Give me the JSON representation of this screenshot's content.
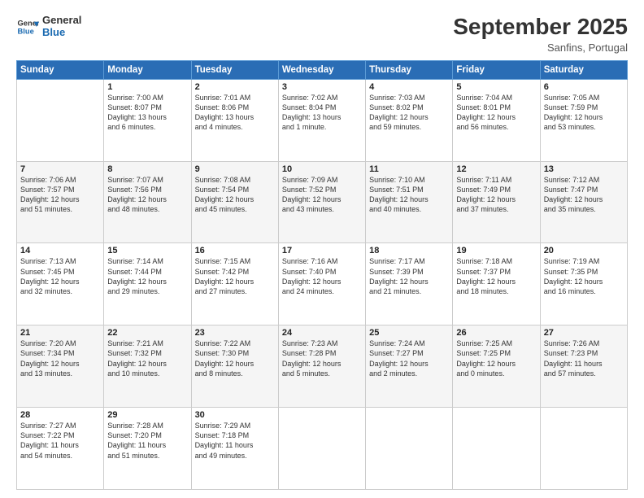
{
  "logo": {
    "line1": "General",
    "line2": "Blue"
  },
  "title": "September 2025",
  "subtitle": "Sanfins, Portugal",
  "days_header": [
    "Sunday",
    "Monday",
    "Tuesday",
    "Wednesday",
    "Thursday",
    "Friday",
    "Saturday"
  ],
  "weeks": [
    [
      {
        "day": "",
        "info": ""
      },
      {
        "day": "1",
        "info": "Sunrise: 7:00 AM\nSunset: 8:07 PM\nDaylight: 13 hours\nand 6 minutes."
      },
      {
        "day": "2",
        "info": "Sunrise: 7:01 AM\nSunset: 8:06 PM\nDaylight: 13 hours\nand 4 minutes."
      },
      {
        "day": "3",
        "info": "Sunrise: 7:02 AM\nSunset: 8:04 PM\nDaylight: 13 hours\nand 1 minute."
      },
      {
        "day": "4",
        "info": "Sunrise: 7:03 AM\nSunset: 8:02 PM\nDaylight: 12 hours\nand 59 minutes."
      },
      {
        "day": "5",
        "info": "Sunrise: 7:04 AM\nSunset: 8:01 PM\nDaylight: 12 hours\nand 56 minutes."
      },
      {
        "day": "6",
        "info": "Sunrise: 7:05 AM\nSunset: 7:59 PM\nDaylight: 12 hours\nand 53 minutes."
      }
    ],
    [
      {
        "day": "7",
        "info": "Sunrise: 7:06 AM\nSunset: 7:57 PM\nDaylight: 12 hours\nand 51 minutes."
      },
      {
        "day": "8",
        "info": "Sunrise: 7:07 AM\nSunset: 7:56 PM\nDaylight: 12 hours\nand 48 minutes."
      },
      {
        "day": "9",
        "info": "Sunrise: 7:08 AM\nSunset: 7:54 PM\nDaylight: 12 hours\nand 45 minutes."
      },
      {
        "day": "10",
        "info": "Sunrise: 7:09 AM\nSunset: 7:52 PM\nDaylight: 12 hours\nand 43 minutes."
      },
      {
        "day": "11",
        "info": "Sunrise: 7:10 AM\nSunset: 7:51 PM\nDaylight: 12 hours\nand 40 minutes."
      },
      {
        "day": "12",
        "info": "Sunrise: 7:11 AM\nSunset: 7:49 PM\nDaylight: 12 hours\nand 37 minutes."
      },
      {
        "day": "13",
        "info": "Sunrise: 7:12 AM\nSunset: 7:47 PM\nDaylight: 12 hours\nand 35 minutes."
      }
    ],
    [
      {
        "day": "14",
        "info": "Sunrise: 7:13 AM\nSunset: 7:45 PM\nDaylight: 12 hours\nand 32 minutes."
      },
      {
        "day": "15",
        "info": "Sunrise: 7:14 AM\nSunset: 7:44 PM\nDaylight: 12 hours\nand 29 minutes."
      },
      {
        "day": "16",
        "info": "Sunrise: 7:15 AM\nSunset: 7:42 PM\nDaylight: 12 hours\nand 27 minutes."
      },
      {
        "day": "17",
        "info": "Sunrise: 7:16 AM\nSunset: 7:40 PM\nDaylight: 12 hours\nand 24 minutes."
      },
      {
        "day": "18",
        "info": "Sunrise: 7:17 AM\nSunset: 7:39 PM\nDaylight: 12 hours\nand 21 minutes."
      },
      {
        "day": "19",
        "info": "Sunrise: 7:18 AM\nSunset: 7:37 PM\nDaylight: 12 hours\nand 18 minutes."
      },
      {
        "day": "20",
        "info": "Sunrise: 7:19 AM\nSunset: 7:35 PM\nDaylight: 12 hours\nand 16 minutes."
      }
    ],
    [
      {
        "day": "21",
        "info": "Sunrise: 7:20 AM\nSunset: 7:34 PM\nDaylight: 12 hours\nand 13 minutes."
      },
      {
        "day": "22",
        "info": "Sunrise: 7:21 AM\nSunset: 7:32 PM\nDaylight: 12 hours\nand 10 minutes."
      },
      {
        "day": "23",
        "info": "Sunrise: 7:22 AM\nSunset: 7:30 PM\nDaylight: 12 hours\nand 8 minutes."
      },
      {
        "day": "24",
        "info": "Sunrise: 7:23 AM\nSunset: 7:28 PM\nDaylight: 12 hours\nand 5 minutes."
      },
      {
        "day": "25",
        "info": "Sunrise: 7:24 AM\nSunset: 7:27 PM\nDaylight: 12 hours\nand 2 minutes."
      },
      {
        "day": "26",
        "info": "Sunrise: 7:25 AM\nSunset: 7:25 PM\nDaylight: 12 hours\nand 0 minutes."
      },
      {
        "day": "27",
        "info": "Sunrise: 7:26 AM\nSunset: 7:23 PM\nDaylight: 11 hours\nand 57 minutes."
      }
    ],
    [
      {
        "day": "28",
        "info": "Sunrise: 7:27 AM\nSunset: 7:22 PM\nDaylight: 11 hours\nand 54 minutes."
      },
      {
        "day": "29",
        "info": "Sunrise: 7:28 AM\nSunset: 7:20 PM\nDaylight: 11 hours\nand 51 minutes."
      },
      {
        "day": "30",
        "info": "Sunrise: 7:29 AM\nSunset: 7:18 PM\nDaylight: 11 hours\nand 49 minutes."
      },
      {
        "day": "",
        "info": ""
      },
      {
        "day": "",
        "info": ""
      },
      {
        "day": "",
        "info": ""
      },
      {
        "day": "",
        "info": ""
      }
    ]
  ]
}
